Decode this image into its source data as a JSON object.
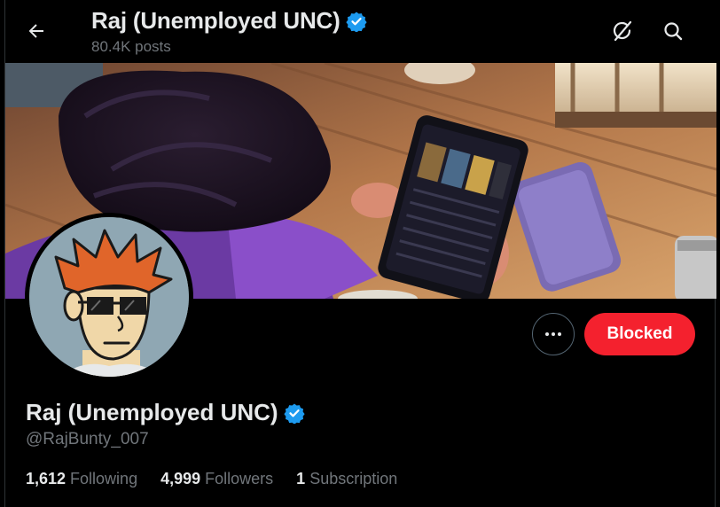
{
  "header": {
    "name": "Raj (Unemployed UNC)",
    "posts": "80.4K posts"
  },
  "profile": {
    "name": "Raj (Unemployed UNC)",
    "handle": "@RajBunty_007"
  },
  "actions": {
    "blocked_label": "Blocked"
  },
  "stats": [
    {
      "number": "1,612",
      "label": "Following"
    },
    {
      "number": "4,999",
      "label": "Followers"
    },
    {
      "number": "1",
      "label": "Subscription"
    }
  ],
  "colors": {
    "verified": "#1d9bf0",
    "blocked": "#f4212e",
    "muted": "#71767b"
  },
  "icons": {
    "back": "back-arrow-icon",
    "grok": "grok-icon",
    "search": "search-icon",
    "verified": "verified-badge-icon",
    "more": "more-icon"
  }
}
